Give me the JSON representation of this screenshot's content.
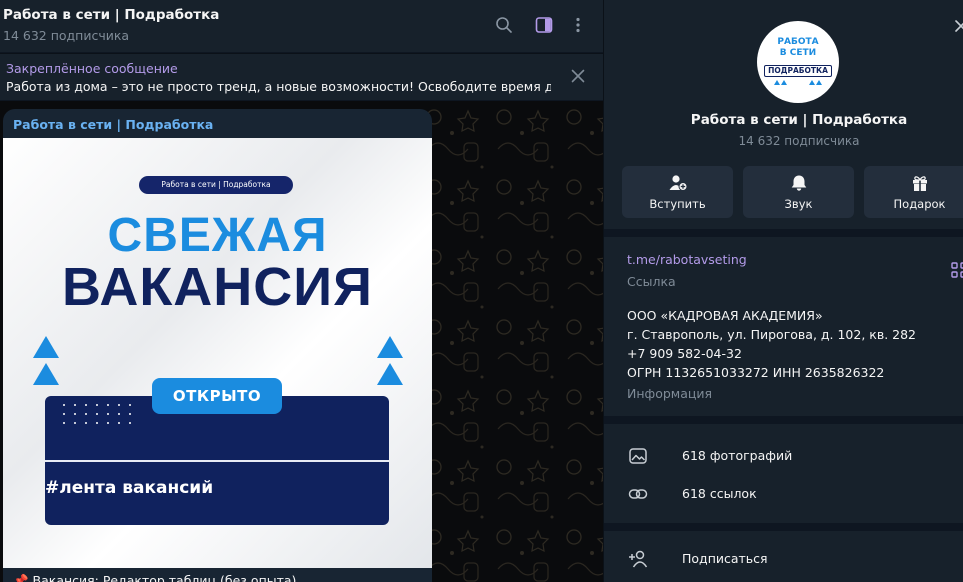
{
  "chat": {
    "title": "Работа в сети | Подработка",
    "subscribers": "14 632 подписчика",
    "icons": {
      "search": "search-icon",
      "sidebar": "sidebar-toggle-icon",
      "more": "more-vertical-icon"
    },
    "pinned": {
      "label": "Закреплённое сообщение",
      "text": "Работа из дома – это не просто тренд, а новые возможности!  Освободите время для..."
    },
    "message": {
      "author": "Работа в сети | Подработка",
      "image": {
        "pill": "Работа в сети | Подработка",
        "line1": "СВЕЖАЯ",
        "line2": "ВАКАНСИЯ",
        "badge": "ОТКРЫТО",
        "tag": "#лента вакансий"
      },
      "caption": "📌 Вакансия: Редактор таблиц (без опыта)"
    }
  },
  "panel": {
    "avatar": {
      "line1": "РАБОТА",
      "line2": "В СЕТИ",
      "line3": "ПОДРАБОТКА"
    },
    "title": "Работа в сети | Подработка",
    "subscribers": "14 632 подписчика",
    "actions": [
      {
        "label": "Вступить",
        "icon": "add-user-icon"
      },
      {
        "label": "Звук",
        "icon": "bell-icon"
      },
      {
        "label": "Подарок",
        "icon": "gift-icon"
      }
    ],
    "link": {
      "value": "t.me/rabotavseting",
      "label": "Ссылка"
    },
    "info": {
      "lines": [
        "ООО «КАДРОВАЯ АКАДЕМИЯ»",
        "г. Ставрополь, ул. Пирогова, д. 102, кв. 282",
        "+7 909 582-04-32",
        "ОГРН 1132651033272 ИНН 2635826322"
      ],
      "label": "Информация"
    },
    "media": [
      {
        "label": "618 фотографий",
        "icon": "photo-icon"
      },
      {
        "label": "618 ссылок",
        "icon": "link-icon"
      }
    ],
    "subscribe": {
      "label": "Подписаться",
      "icon": "add-user-icon"
    }
  },
  "colors": {
    "bg_panel": "#17212b",
    "bg_chat": "#0e1621",
    "accent_link": "#b39be9",
    "accent_blue": "#6ab2f2",
    "text_muted": "#7f8b97",
    "brand_blue": "#1b8cdf",
    "brand_navy": "#10225e"
  }
}
